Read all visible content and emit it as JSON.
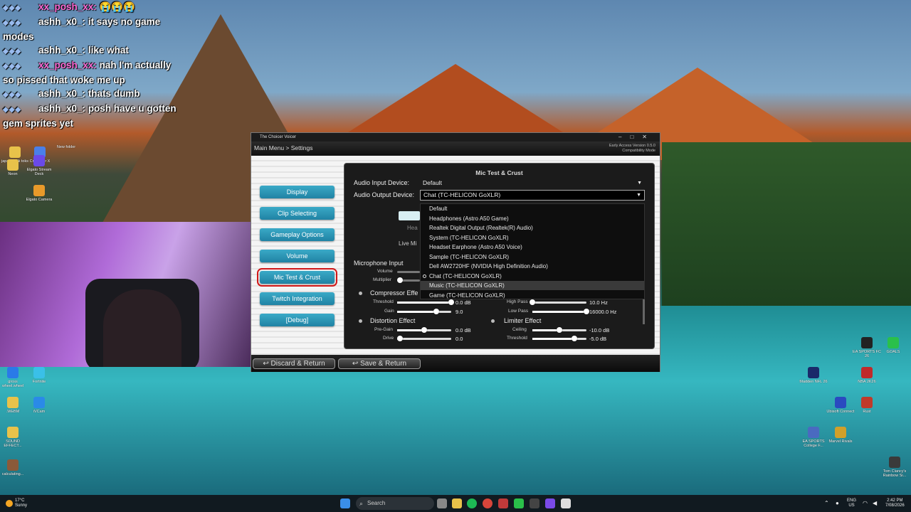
{
  "chat": {
    "lines": [
      {
        "user": "xx_posh_xx:",
        "msg": "😭😭😭"
      },
      {
        "user": "ashh_x0_:",
        "msg": "it says no game modes"
      },
      {
        "user": "ashh_x0_:",
        "msg": "like what"
      },
      {
        "user": "xx_posh_xx:",
        "msg": "nah I'm actually so pissed that woke me up"
      },
      {
        "user": "ashh_x0_:",
        "msg": "thats dumb"
      },
      {
        "user": "ashh_x0_:",
        "msg": "posh have u gotten gem sprites yet"
      }
    ]
  },
  "desktop_icons_left": [
    {
      "label": "japan id tik toks",
      "color": "#e8c24a"
    },
    {
      "label": "Crosshair X",
      "color": "#4a7fe8"
    },
    {
      "label": "New folder",
      "color": "#e8c24a"
    },
    {
      "label": "Neon",
      "color": "#e8c24a"
    },
    {
      "label": "Elgato Stream Deck",
      "color": "#6a4ae8"
    },
    {
      "label": "Elgato Camera",
      "color": "#e89a2a"
    },
    {
      "label": "gross wheel.wheel",
      "color": "#2a7ae8"
    },
    {
      "label": "Fortnite",
      "color": "#3ac0e8"
    },
    {
      "label": ".WEBM",
      "color": "#e8c24a"
    },
    {
      "label": "iVCam",
      "color": "#2a8ae8"
    },
    {
      "label": "SOUND EFFECT...",
      "color": "#e8c24a"
    },
    {
      "label": "calculating...",
      "color": "#8a5a3a"
    }
  ],
  "desktop_icons_right": [
    {
      "label": "EA SPORTS FC 26",
      "color": "#222"
    },
    {
      "label": "GOALS",
      "color": "#2ac04a"
    },
    {
      "label": "Madden NFL 26",
      "color": "#1a2a6a"
    },
    {
      "label": "NBA 2K26",
      "color": "#c02a2a"
    },
    {
      "label": "Ubisoft Connect",
      "color": "#2a4ac0"
    },
    {
      "label": "Rust",
      "color": "#c03a2a"
    },
    {
      "label": "EA SPORTS College F...",
      "color": "#4a6ac0"
    },
    {
      "label": "Marvel Rivals",
      "color": "#d0a02a"
    },
    {
      "label": "Tom Clancy's Rainbow Si...",
      "color": "#3a3a3a"
    }
  ],
  "app": {
    "window_title": "The Choicer Voicer",
    "breadcrumb": "Main Menu > Settings",
    "version_line1": "Early Access Version 0.5.0",
    "version_line2": "Compatibility Mode",
    "nav": [
      "Display",
      "Clip Selecting",
      "Gameplay Options",
      "Volume",
      "Mic Test & Crust",
      "Twitch Integration",
      "[Debug]"
    ],
    "selected_nav": "Mic Test & Crust",
    "discard_label": "Discard & Return",
    "save_label": "Save & Return",
    "panel": {
      "title": "Mic Test & Crust",
      "input_label": "Audio Input Device:",
      "input_value": "Default",
      "output_label": "Audio Output Device:",
      "output_value": "Chat (TC-HELICON GoXLR)",
      "dropdown_options": [
        "Default",
        "Headphones (Astro A50 Game)",
        "Realtek Digital Output (Realtek(R) Audio)",
        "System (TC-HELICON GoXLR)",
        "Headset Earphone (Astro A50 Voice)",
        "Sample (TC-HELICON GoXLR)",
        "Dell AW2720HF (NVIDIA High Definition Audio)",
        "Chat (TC-HELICON GoXLR)",
        "Music (TC-HELICON GoXLR)",
        "Game (TC-HELICON GoXLR)"
      ],
      "selected_option": "Chat (TC-HELICON GoXLR)",
      "hovered_option": "Music (TC-HELICON GoXLR)",
      "live_mic_partial": "Live Mi",
      "head_partial": "Hea",
      "mic_input_label": "Microphone Input",
      "volume_label": "Volume",
      "multiplier_label": "Multiplier",
      "compressor_label": "Compressor Effe",
      "threshold_label": "Threshold",
      "threshold_value": "0.0 dB",
      "gain_label": "Gain",
      "gain_value": "9.0",
      "high_pass_label": "High Pass",
      "high_pass_value": "10.0 Hz",
      "low_pass_label": "Low Pass",
      "low_pass_value": "16000.0 Hz",
      "distortion_label": "Distortion Effect",
      "pregain_label": "Pre-Gain",
      "pregain_value": "0.0 dB",
      "drive_label": "Drive",
      "drive_value": "0.0",
      "limiter_label": "Limiter Effect",
      "ceiling_label": "Ceiling",
      "ceiling_value": "-10.0 dB",
      "lim_threshold_label": "Threshold",
      "lim_threshold_value": "-5.0 dB",
      "slider_levels": {
        "threshold": 1.0,
        "gain": 0.72,
        "high_pass": 0.0,
        "low_pass": 1.0,
        "pregain": 0.5,
        "drive": 0.05,
        "ceiling": 0.5,
        "lim_threshold": 0.78
      }
    }
  },
  "taskbar": {
    "weather_temp": "17°C",
    "weather_desc": "Sunny",
    "search_placeholder": "Search",
    "lang_line1": "ENG",
    "lang_line2": "US",
    "time": "2:42 PM",
    "date": "7/08/2026"
  }
}
